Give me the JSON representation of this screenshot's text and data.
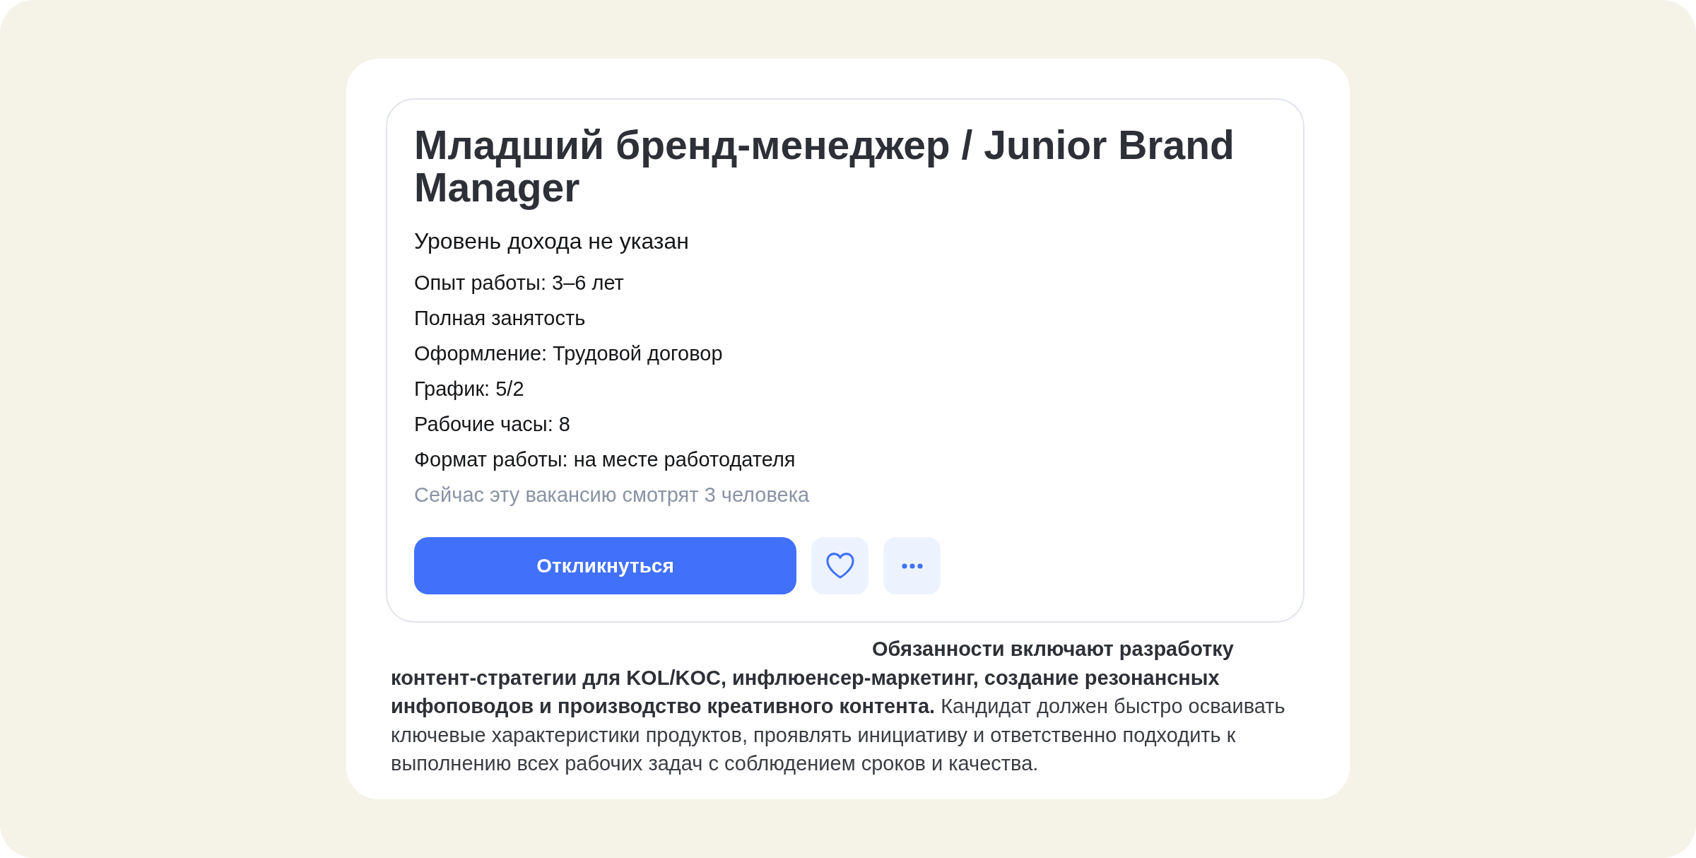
{
  "vacancy": {
    "title": "Младший бренд-менеджер / Junior Brand Manager",
    "salary": "Уровень дохода не указан",
    "details": [
      "Опыт работы: 3–6 лет",
      "Полная занятость",
      "Оформление: Трудовой договор",
      "График: 5/2",
      "Рабочие часы: 8",
      "Формат работы: на месте работодателя"
    ],
    "viewers_note": "Сейчас эту вакансию смотрят 3 человека",
    "actions": [
      {
        "kind": "apply",
        "label": "Откликнуться"
      },
      {
        "kind": "favorite",
        "on": false
      },
      {
        "kind": "more"
      }
    ]
  },
  "description": "**Обязанности включают разработку контент-стратегии для KOL/KOC, инфлюенсер-маркетинг, создание резонансных инфоповодов и производство креативного контента.** Кандидат должен быстро осваивать ключевые характеристики продуктов, проявлять инициативу и ответственно подходить к выполнению всех рабочих задач с соблюдением сроков и качества."
}
